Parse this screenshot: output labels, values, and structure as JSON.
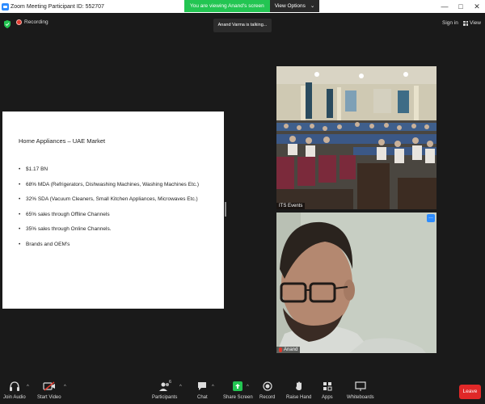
{
  "window": {
    "title": "Zoom Meeting Participant ID: 552707",
    "viewing_notice": "You are viewing Anand's screen",
    "view_options": "View Options"
  },
  "topbar": {
    "recording": "Recording",
    "talking": "Anand Varma is talking...",
    "sign_in": "Sign in",
    "view": "View"
  },
  "slide": {
    "title": "Home Appliances – UAE Market",
    "bullets": [
      "$1.17 BN",
      "68% MDA (Refrigerators, Dishwashing Machines, Washing Machines Etc.)",
      "32% SDA (Vacuum Cleaners, Small Kitchen Appliances, Microwaves Etc.)",
      "65% sales through Offline Channels",
      "35% sales through Online Channels.",
      "Brands and OEM's"
    ]
  },
  "videos": {
    "events_name": "ITS Events",
    "speaker_name": "Anand"
  },
  "toolbar": {
    "join_audio": "Join Audio",
    "start_video": "Start Video",
    "participants": "Participants",
    "participants_count": "6",
    "chat": "Chat",
    "share_screen": "Share Screen",
    "record": "Record",
    "raise_hand": "Raise Hand",
    "apps": "Apps",
    "whiteboards": "Whiteboards",
    "leave": "Leave"
  },
  "colors": {
    "accent_blue": "#2d8cff",
    "share_green": "#23c552",
    "leave_red": "#e02828",
    "background": "#1a1a1a"
  }
}
